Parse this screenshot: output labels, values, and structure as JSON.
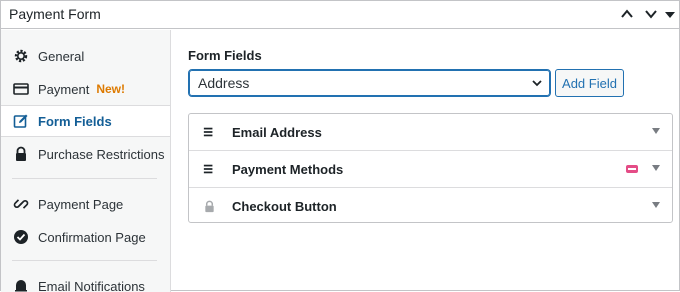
{
  "header": {
    "title": "Payment Form",
    "collapse_up_icon": "chevron-up-icon",
    "collapse_down_icon": "chevron-down-icon"
  },
  "sidebar": {
    "items": [
      {
        "label": "General",
        "icon": "gear-icon"
      },
      {
        "label": "Payment",
        "icon": "payment-card-icon",
        "badge": "New!"
      },
      {
        "label": "Form Fields",
        "icon": "edit-icon",
        "active": true
      },
      {
        "label": "Purchase Restrictions",
        "icon": "lock-icon"
      },
      {
        "label": "Payment Page",
        "icon": "link-icon"
      },
      {
        "label": "Confirmation Page",
        "icon": "check-circle-icon"
      },
      {
        "label": "Email Notifications",
        "icon": "bell-icon"
      }
    ]
  },
  "main": {
    "form_fields_label": "Form Fields",
    "select_value": "Address",
    "add_field_label": "Add Field",
    "fields": [
      {
        "label": "Email Address",
        "icon": "drag-handle-icon"
      },
      {
        "label": "Payment Methods",
        "icon": "drag-handle-icon"
      },
      {
        "label": "Checkout Button",
        "icon": "lock-icon"
      }
    ]
  },
  "colors": {
    "accent": "#2271b1",
    "badge": "#dd7a00",
    "active_text": "#135e96"
  }
}
